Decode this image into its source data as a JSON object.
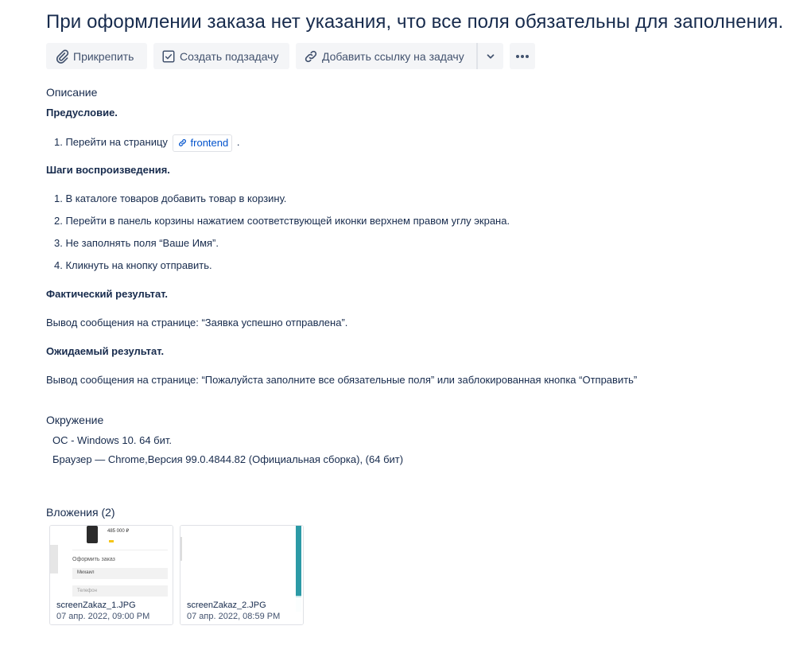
{
  "issue": {
    "title": "При оформлении заказа нет указания, что все поля обязательны для заполнения."
  },
  "toolbar": {
    "attach_label": "Прикрепить",
    "subtask_label": "Создать подзадачу",
    "link_label": "Добавить ссылку на задачу",
    "icons": [
      "paperclip-icon",
      "subtask-icon",
      "link-icon",
      "chevron-down-icon",
      "more-icon"
    ]
  },
  "description": {
    "label": "Описание",
    "precondition_heading": "Предусловие.",
    "precondition_prefix": "1. Перейти на страницу",
    "precondition_link": "frontend",
    "precondition_suffix": ".",
    "steps_heading": "Шаги воспроизведения.",
    "steps": [
      "1. В каталоге товаров добавить товар в корзину.",
      "2. Перейти в панель корзины нажатием соответствующей иконки верхнем правом углу экрана.",
      "3. Не заполнять поля “Ваше Имя”.",
      "4. Кликнуть на кнопку отправить."
    ],
    "actual_heading": "Фактический результат.",
    "actual_text": "Вывод сообщения на странице: “Заявка успешно отправлена”.",
    "expected_heading": "Ожидаемый результат.",
    "expected_text": "Вывод сообщения на странице: “Пожалуйста заполните все обязательные поля” или заблокированная кнопка “Отправить”"
  },
  "environment": {
    "label": "Окружение",
    "lines": [
      "ОС - Windows 10. 64 бит.",
      "Браузер — Chrome,Версия 99.0.4844.82 (Официальная сборка), (64 бит)"
    ]
  },
  "attachments": {
    "label": "Вложения (2)",
    "items": [
      {
        "name": "screenZakaz_1.JPG",
        "date": "07 апр. 2022, 09:00 PM",
        "thumb": {
          "price": "485 000 ₽",
          "form_title": "Оформить заказ",
          "name_value": "Михаил",
          "phone_placeholder": "Телефон"
        }
      },
      {
        "name": "screenZakaz_2.JPG",
        "date": "07 апр. 2022, 08:59 PM"
      }
    ]
  },
  "colors": {
    "accent": "#0052cc",
    "text": "#172b4d",
    "button_bg": "#f4f5f7",
    "thumb_teal": "#2c9aa6"
  }
}
